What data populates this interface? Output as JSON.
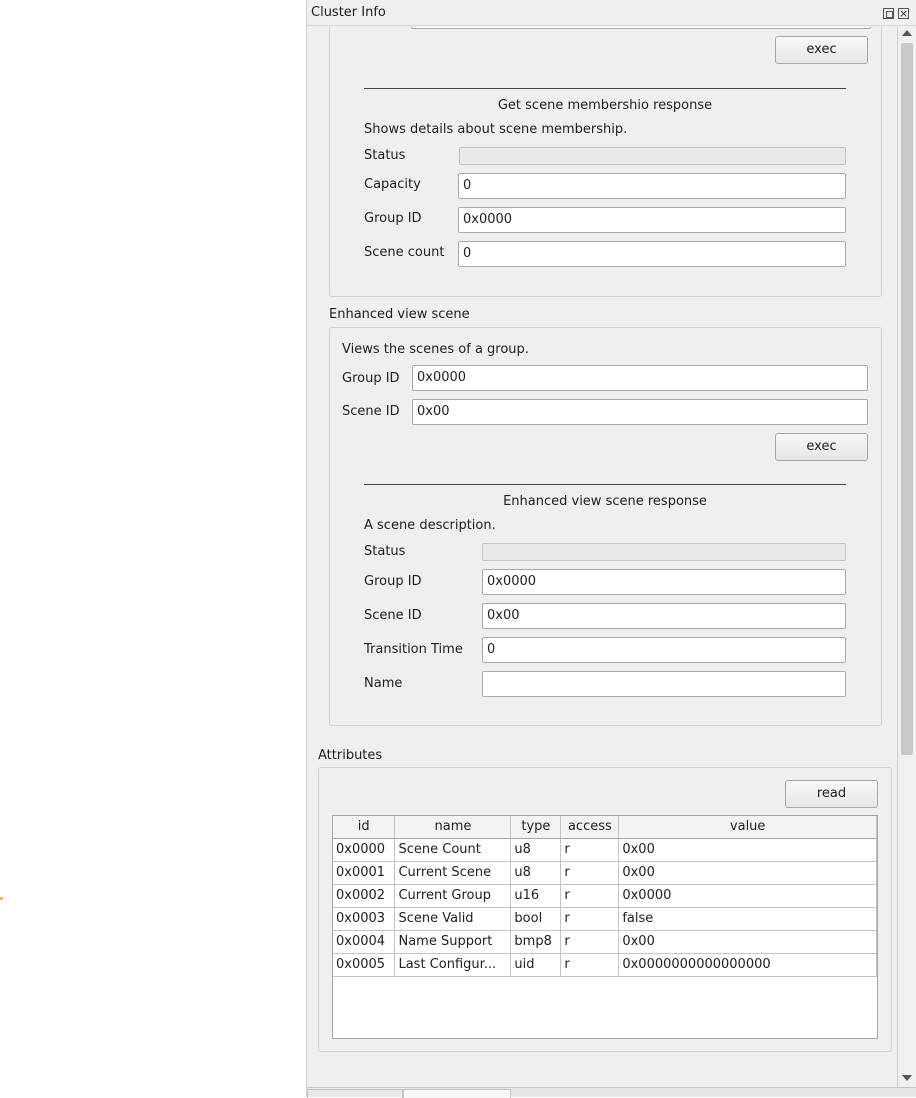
{
  "dock": {
    "title": "Cluster Info"
  },
  "get_membership": {
    "exec_label": "exec",
    "response_title": "Get scene membershio response",
    "description": "Shows details about scene membership.",
    "fields": {
      "status_label": "Status",
      "capacity_label": "Capacity",
      "capacity_value": "0",
      "group_id_label": "Group ID",
      "group_id_value": "0x0000",
      "scene_count_label": "Scene count",
      "scene_count_value": "0"
    }
  },
  "enhanced_view": {
    "section_title": "Enhanced view scene",
    "description": "Views the scenes of a group.",
    "group_id_label": "Group ID",
    "group_id_value": "0x0000",
    "scene_id_label": "Scene ID",
    "scene_id_value": "0x00",
    "exec_label": "exec",
    "response": {
      "title": "Enhanced view scene response",
      "description": "A scene description.",
      "status_label": "Status",
      "group_id_label": "Group ID",
      "group_id_value": "0x0000",
      "scene_id_label": "Scene ID",
      "scene_id_value": "0x00",
      "transition_time_label": "Transition Time",
      "transition_time_value": "0",
      "name_label": "Name",
      "name_value": ""
    }
  },
  "attributes": {
    "section_title": "Attributes",
    "read_label": "read",
    "columns": [
      "id",
      "name",
      "type",
      "access",
      "value"
    ],
    "rows": [
      [
        "0x0000",
        "Scene Count",
        "u8",
        "r",
        "0x00"
      ],
      [
        "0x0001",
        "Current Scene",
        "u8",
        "r",
        "0x00"
      ],
      [
        "0x0002",
        "Current Group",
        "u16",
        "r",
        "0x0000"
      ],
      [
        "0x0003",
        "Scene Valid",
        "bool",
        "r",
        "false"
      ],
      [
        "0x0004",
        "Name Support",
        "bmp8",
        "r",
        "0x00"
      ],
      [
        "0x0005",
        "Last Configur...",
        "uid",
        "r",
        "0x0000000000000000"
      ]
    ]
  }
}
